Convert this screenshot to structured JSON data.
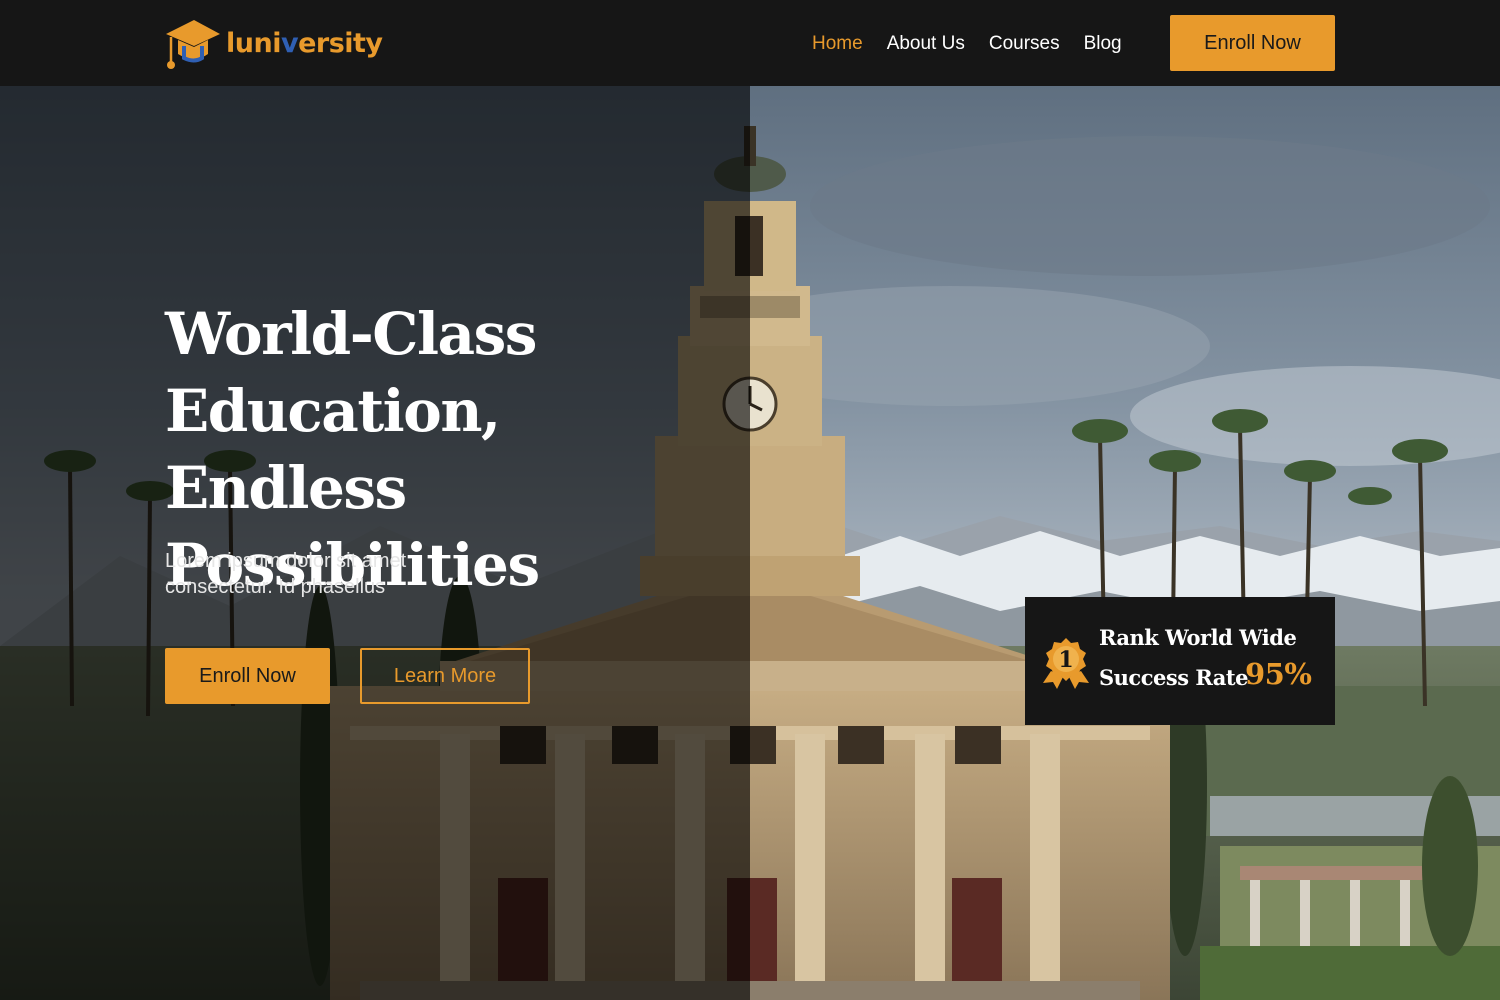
{
  "brand": {
    "name_part1": "luni",
    "name_part2": "v",
    "name_part3": "ersity",
    "logo_icon": "graduation-cap-icon",
    "accent_color": "#e89a2c",
    "secondary_color": "#2f5fb3"
  },
  "nav": {
    "links": [
      {
        "label": "Home",
        "active": true
      },
      {
        "label": "About Us",
        "active": false
      },
      {
        "label": "Courses",
        "active": false
      },
      {
        "label": "Blog",
        "active": false
      }
    ],
    "cta_label": "Enroll Now"
  },
  "hero": {
    "title": "World-Class Education, Endless Possibilities",
    "subtitle": "Lorem ipsum dolor sit amet consectetur. Id phasellus",
    "primary_button": "Enroll Now",
    "secondary_button": "Learn More"
  },
  "rank_card": {
    "badge_icon": "award-ribbon-icon",
    "badge_number": "1",
    "line1": "Rank World Wide",
    "line2": "Success Rate",
    "percentage": "95%"
  }
}
